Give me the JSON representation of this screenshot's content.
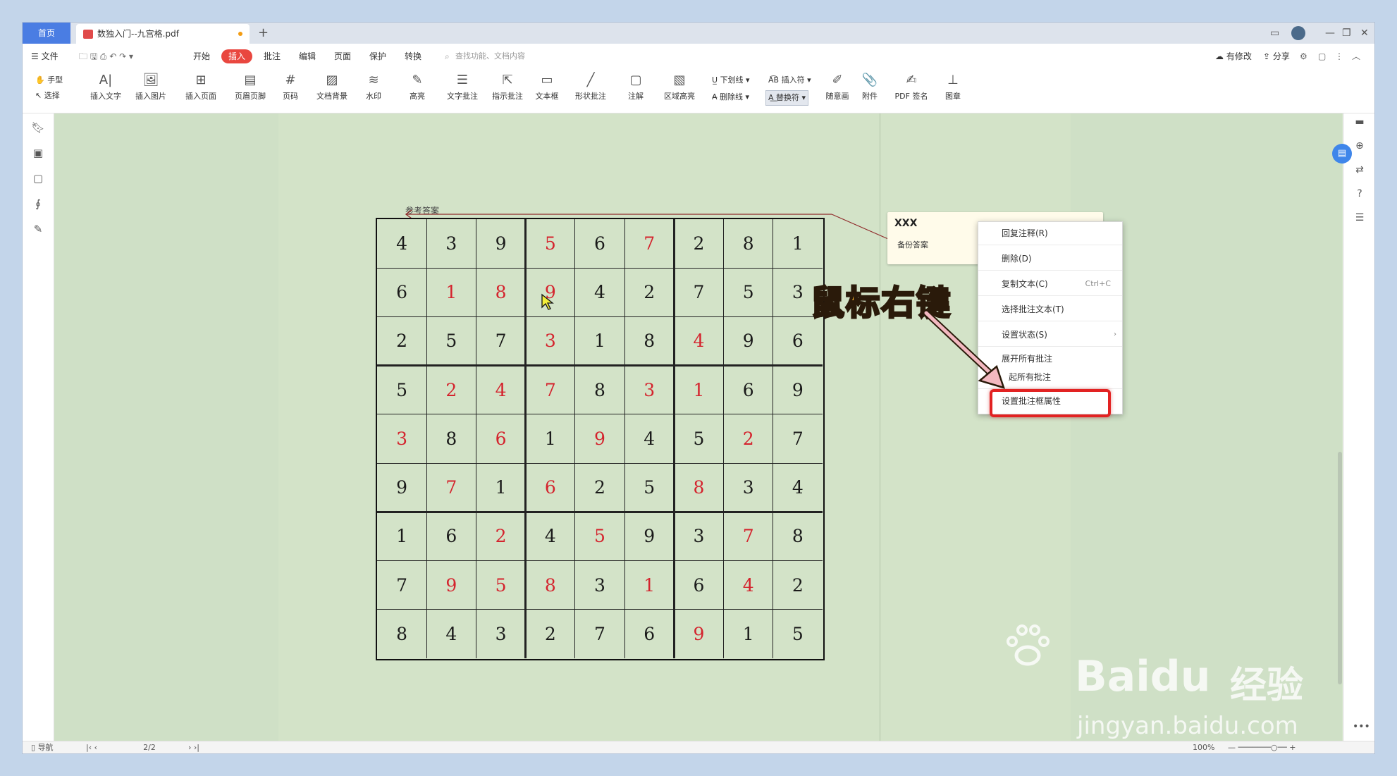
{
  "tabs": {
    "home": "首页",
    "doc_title": "数独入门--九宫格.pdf",
    "add": "+"
  },
  "menu": {
    "file": "文件",
    "items": [
      "开始",
      "插入",
      "批注",
      "编辑",
      "页面",
      "保护",
      "转换"
    ],
    "active": "插入",
    "search_placeholder": "查找功能、文档内容",
    "modified": "有修改",
    "share": "分享"
  },
  "ribbon": {
    "hand": "手型",
    "select": "选择",
    "buttons": [
      "插入文字",
      "插入图片",
      "插入页面",
      "页眉页脚",
      "页码",
      "文档背景",
      "水印",
      "高亮",
      "文字批注",
      "指示批注",
      "文本框",
      "形状批注",
      "注解",
      "区域高亮"
    ],
    "underline": "下划线",
    "strikethrough": "删除线",
    "insert_mark": "插入符",
    "replace_mark": "替换符",
    "buttons2": [
      "随意画",
      "附件",
      "PDF 签名",
      "图章"
    ]
  },
  "document": {
    "answer_label": "参考答案",
    "sudoku": [
      [
        [
          4,
          0
        ],
        [
          3,
          0
        ],
        [
          9,
          0
        ],
        [
          5,
          1
        ],
        [
          6,
          0
        ],
        [
          7,
          1
        ],
        [
          2,
          0
        ],
        [
          8,
          0
        ],
        [
          1,
          0
        ]
      ],
      [
        [
          6,
          0
        ],
        [
          1,
          1
        ],
        [
          8,
          1
        ],
        [
          9,
          1
        ],
        [
          4,
          0
        ],
        [
          2,
          0
        ],
        [
          7,
          0
        ],
        [
          5,
          0
        ],
        [
          3,
          0
        ]
      ],
      [
        [
          2,
          0
        ],
        [
          5,
          0
        ],
        [
          7,
          0
        ],
        [
          3,
          1
        ],
        [
          1,
          0
        ],
        [
          8,
          0
        ],
        [
          4,
          1
        ],
        [
          9,
          0
        ],
        [
          6,
          0
        ]
      ],
      [
        [
          5,
          0
        ],
        [
          2,
          1
        ],
        [
          4,
          1
        ],
        [
          7,
          1
        ],
        [
          8,
          0
        ],
        [
          3,
          1
        ],
        [
          1,
          1
        ],
        [
          6,
          0
        ],
        [
          9,
          0
        ]
      ],
      [
        [
          3,
          1
        ],
        [
          8,
          0
        ],
        [
          6,
          1
        ],
        [
          1,
          0
        ],
        [
          9,
          1
        ],
        [
          4,
          0
        ],
        [
          5,
          0
        ],
        [
          2,
          1
        ],
        [
          7,
          0
        ]
      ],
      [
        [
          9,
          0
        ],
        [
          7,
          1
        ],
        [
          1,
          0
        ],
        [
          6,
          1
        ],
        [
          2,
          0
        ],
        [
          5,
          0
        ],
        [
          8,
          1
        ],
        [
          3,
          0
        ],
        [
          4,
          0
        ]
      ],
      [
        [
          1,
          0
        ],
        [
          6,
          0
        ],
        [
          2,
          1
        ],
        [
          4,
          0
        ],
        [
          5,
          1
        ],
        [
          9,
          0
        ],
        [
          3,
          0
        ],
        [
          7,
          1
        ],
        [
          8,
          0
        ]
      ],
      [
        [
          7,
          0
        ],
        [
          9,
          1
        ],
        [
          5,
          1
        ],
        [
          8,
          1
        ],
        [
          3,
          0
        ],
        [
          1,
          1
        ],
        [
          6,
          0
        ],
        [
          4,
          1
        ],
        [
          2,
          0
        ]
      ],
      [
        [
          8,
          0
        ],
        [
          4,
          0
        ],
        [
          3,
          0
        ],
        [
          2,
          0
        ],
        [
          7,
          0
        ],
        [
          6,
          0
        ],
        [
          9,
          1
        ],
        [
          1,
          0
        ],
        [
          5,
          0
        ]
      ]
    ],
    "colors": {
      "given": "#1a1a1a",
      "filled": "#d4232d"
    }
  },
  "comment": {
    "author": "XXX",
    "text": "备份答案"
  },
  "context_menu": {
    "items": [
      {
        "label": "回复注释(R)",
        "shortcut": ""
      },
      {
        "label": "删除(D)",
        "shortcut": ""
      },
      {
        "label": "复制文本(C)",
        "shortcut": "Ctrl+C"
      },
      {
        "label": "选择批注文本(T)",
        "shortcut": ""
      },
      {
        "label": "设置状态(S)",
        "shortcut": ""
      },
      {
        "label": "展开所有批注",
        "shortcut": ""
      },
      {
        "label": "起所有批注",
        "shortcut": ""
      },
      {
        "label": "设置批注框属性",
        "shortcut": ""
      }
    ]
  },
  "annotation": "鼠标右键",
  "statusbar": {
    "nav": "导航",
    "page": "2/2",
    "zoom": "100%"
  },
  "watermark": {
    "brand_a": "Bai",
    "brand_b": "du",
    "brand_cn": "经验",
    "url": "jingyan.baidu.com"
  }
}
